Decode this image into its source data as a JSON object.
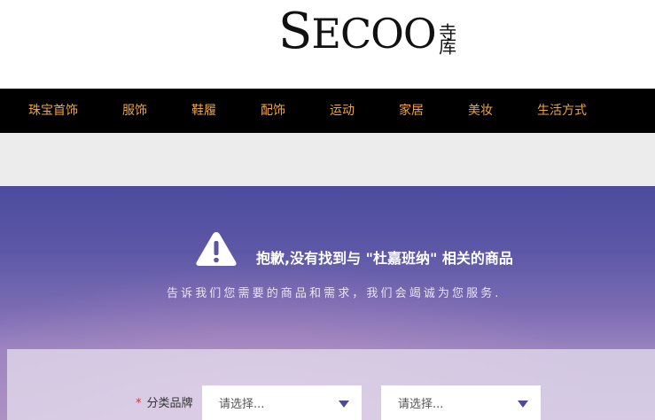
{
  "logo": {
    "wordmark_first": "S",
    "wordmark_rest": "ECOO",
    "cn": "寺库"
  },
  "nav": {
    "items": [
      {
        "label": "珠宝首饰"
      },
      {
        "label": "服饰"
      },
      {
        "label": "鞋履"
      },
      {
        "label": "配饰"
      },
      {
        "label": "运动"
      },
      {
        "label": "家居"
      },
      {
        "label": "美妆"
      },
      {
        "label": "生活方式"
      }
    ],
    "color": "#f0a33a"
  },
  "notice": {
    "icon": "warning-icon",
    "title": "抱歉,没有找到与 \"杜嘉班纳\" 相关的商品",
    "subtitle": "告诉我们您需要的商品和需求，我们会竭诚为您服务."
  },
  "form": {
    "required_mark": "*",
    "category_label": "分类品牌",
    "select_primary": {
      "value": "请选择..."
    },
    "select_secondary": {
      "value": "请选择..."
    }
  }
}
